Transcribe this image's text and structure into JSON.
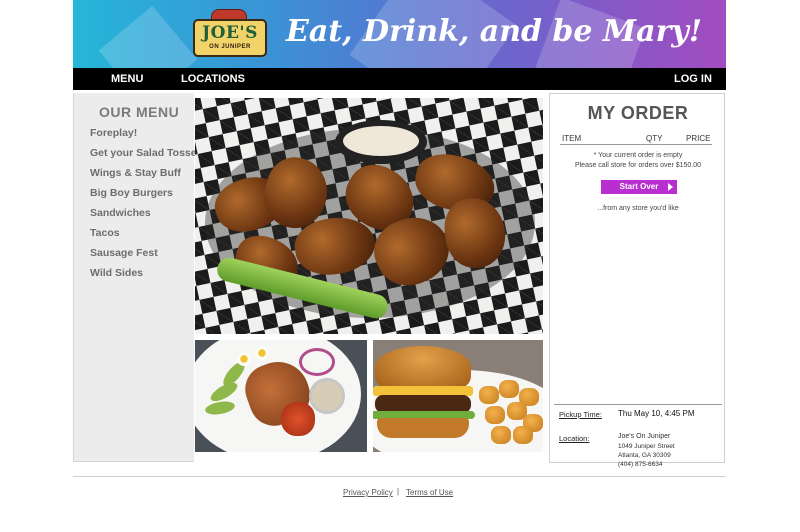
{
  "header": {
    "logo": {
      "name": "JOE'S",
      "subtitle": "ON JUNIPER"
    },
    "tagline": "Eat, Drink, and be Mary!"
  },
  "nav": {
    "menu": "MENU",
    "locations": "LOCATIONS",
    "login": "LOG IN"
  },
  "menu": {
    "title": "OUR MENU",
    "items": [
      {
        "label": "Foreplay!"
      },
      {
        "label": "Get your Salad Tossed"
      },
      {
        "label": "Wings & Stay Buff"
      },
      {
        "label": "Big Boy Burgers"
      },
      {
        "label": "Sandwiches"
      },
      {
        "label": "Tacos"
      },
      {
        "label": "Sausage Fest"
      },
      {
        "label": "Wild Sides"
      }
    ]
  },
  "order": {
    "title": "MY ORDER",
    "columns": {
      "item": "ITEM",
      "qty": "QTY",
      "price": "PRICE"
    },
    "empty_note": "* Your current order is empty",
    "call_note": "Please call store for orders over $150.00",
    "start_button": "Start Over",
    "from_any_store": "...from any store you'd like",
    "pickup_label": "Pickup Time:",
    "pickup_value": "Thu May 10, 4:45 PM",
    "location_label": "Location:",
    "location_name": "Joe's On Juniper",
    "address_line1": "1049 Juniper Street",
    "address_line2": "Atlanta, GA 30309",
    "phone": "(404) 875-6634"
  },
  "footer": {
    "privacy": "Privacy Policy",
    "separator": "|",
    "terms": "Terms of Use"
  },
  "colors": {
    "nav_bg": "#000000",
    "accent_button": "#b82ed1",
    "menu_panel_bg": "#ececec",
    "banner_start": "#25b6d8",
    "banner_end": "#a24cbf"
  }
}
